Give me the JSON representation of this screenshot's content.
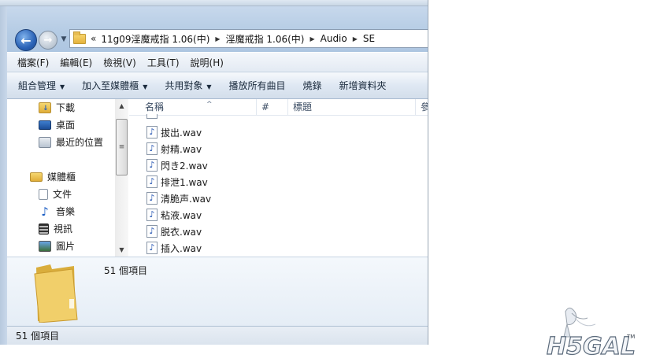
{
  "address_bar": {
    "overflow_chevron": "«",
    "path": [
      "11g09淫魔戒指 1.06(中)",
      "淫魔戒指 1.06(中)",
      "Audio",
      "SE"
    ]
  },
  "menu": [
    "檔案(F)",
    "編輯(E)",
    "檢視(V)",
    "工具(T)",
    "說明(H)"
  ],
  "toolbar": [
    {
      "label": "組合管理",
      "dropdown": true
    },
    {
      "label": "加入至媒體櫃",
      "dropdown": true
    },
    {
      "label": "共用對象",
      "dropdown": true
    },
    {
      "label": "播放所有曲目",
      "dropdown": false
    },
    {
      "label": "燒錄",
      "dropdown": false
    },
    {
      "label": "新增資料夾",
      "dropdown": false
    }
  ],
  "nav_pane": {
    "favorites": [
      {
        "label": "下載",
        "icon": "downloads-folder-icon"
      },
      {
        "label": "桌面",
        "icon": "desktop-icon"
      },
      {
        "label": "最近的位置",
        "icon": "recent-places-icon"
      }
    ],
    "libraries_label": "媒體櫃",
    "libraries": [
      {
        "label": "文件",
        "icon": "documents-icon"
      },
      {
        "label": "音樂",
        "icon": "music-icon"
      },
      {
        "label": "視訊",
        "icon": "video-icon"
      },
      {
        "label": "圖片",
        "icon": "pictures-icon"
      }
    ]
  },
  "columns": [
    "名稱",
    "#",
    "標題",
    "參"
  ],
  "files": [
    "拔出.wav",
    "射精.wav",
    "閃き2.wav",
    "排泄1.wav",
    "清脆声.wav",
    "粘液.wav",
    "脱衣.wav",
    "插入.wav"
  ],
  "details_pane": {
    "count_text": "51 個項目"
  },
  "status_bar": {
    "text": "51 個項目"
  },
  "watermark": {
    "logo_text": "H5GAL",
    "tm": "TM"
  },
  "colors": {
    "accent": "#2a62b6",
    "folder": "#e8c25a",
    "cmdbar": "#dfe8f3"
  }
}
